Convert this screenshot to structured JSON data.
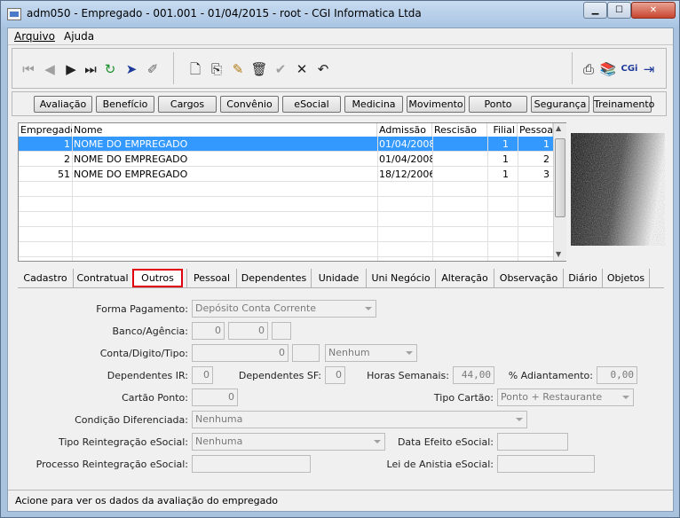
{
  "window": {
    "title": "adm050 - Empregado - 001.001 - 01/04/2015 - root - CGI Informatica Ltda",
    "min": "▁",
    "max": "☐",
    "close": "✕"
  },
  "menu": {
    "arquivo": "Arquivo",
    "ajuda": "Ajuda"
  },
  "toolbar": {
    "nav": [
      "first-icon",
      "prev-icon",
      "next-icon",
      "last-icon",
      "refresh-icon",
      "send-icon",
      "clear-icon"
    ],
    "edit": [
      "new-icon",
      "copy-icon",
      "edit-icon",
      "delete-icon",
      "confirm-icon",
      "cancel-icon",
      "undo-icon"
    ],
    "right": [
      "print-icon",
      "books-icon",
      "cgi-logo",
      "exit-icon"
    ],
    "cgi": "CGi"
  },
  "buttons": [
    "Avaliação",
    "Benefício",
    "Cargos",
    "Convênio",
    "eSocial",
    "Medicina",
    "Movimento",
    "Ponto",
    "Segurança",
    "Treinamento"
  ],
  "grid": {
    "columns": [
      "Empregado",
      "Nome",
      "Admissão",
      "Rescisão",
      "Filial",
      "Pessoa"
    ],
    "rows": [
      [
        "1",
        "NOME DO EMPREGADO",
        "01/04/2008",
        "",
        "1",
        "1"
      ],
      [
        "2",
        "NOME DO EMPREGADO",
        "01/04/2008",
        "",
        "1",
        "2"
      ],
      [
        "51",
        "NOME DO EMPREGADO",
        "18/12/2006",
        "",
        "1",
        "3"
      ]
    ]
  },
  "tabs": [
    "Cadastro",
    "Contratual",
    "Outros",
    "Pessoal",
    "Dependentes",
    "Unidade",
    "Uni Negócio",
    "Alteração",
    "Observação",
    "Diário",
    "Objetos"
  ],
  "active_tab": "Outros",
  "form": {
    "forma_pagamento": {
      "label": "Forma Pagamento:",
      "value": "Depósito Conta Corrente"
    },
    "banco_agencia": {
      "label": "Banco/Agência:",
      "banco": "0",
      "agencia": "0",
      "dig": ""
    },
    "conta": {
      "label": "Conta/Digito/Tipo:",
      "conta": "0",
      "digito": "",
      "tipo": "Nenhum"
    },
    "dependentes_ir": {
      "label": "Dependentes IR:",
      "value": "0"
    },
    "dependentes_sf": {
      "label": "Dependentes SF:",
      "value": "0"
    },
    "horas_semanais": {
      "label": "Horas Semanais:",
      "value": "44,00"
    },
    "adiantamento": {
      "label": "% Adiantamento:",
      "value": "0,00"
    },
    "cartao_ponto": {
      "label": "Cartão Ponto:",
      "value": "0"
    },
    "tipo_cartao": {
      "label": "Tipo Cartão:",
      "value": "Ponto + Restaurante"
    },
    "condicao": {
      "label": "Condição Diferenciada:",
      "value": "Nenhuma"
    },
    "tipo_reintegracao": {
      "label": "Tipo Reintegração eSocial:",
      "value": "Nenhuma"
    },
    "data_efeito": {
      "label": "Data Efeito eSocial:",
      "value": ""
    },
    "processo": {
      "label": "Processo Reintegração eSocial:",
      "value": ""
    },
    "lei_anistia": {
      "label": "Lei de Anistia eSocial:",
      "value": ""
    }
  },
  "status": "Acione para ver os dados da avaliação do empregado"
}
